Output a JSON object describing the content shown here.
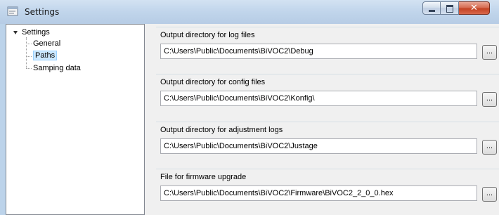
{
  "window": {
    "title": "Settings",
    "app_icon": "settings-window-icon",
    "close_glyph": "✕"
  },
  "tree": {
    "root": "Settings",
    "items": [
      {
        "label": "General",
        "selected": false
      },
      {
        "label": "Paths",
        "selected": true
      },
      {
        "label": "Samping data",
        "selected": false
      }
    ]
  },
  "paths": {
    "log": {
      "label": "Output directory for log files",
      "value": "C:\\Users\\Public\\Documents\\BiVOC2\\Debug"
    },
    "config": {
      "label": "Output directory for config files",
      "value": "C:\\Users\\Public\\Documents\\BiVOC2\\Konfig\\"
    },
    "adjustment": {
      "label": "Output directory for adjustment logs",
      "value": "C:\\Users\\Public\\Documents\\BiVOC2\\Justage"
    },
    "firmware": {
      "label": "File for firmware upgrade",
      "value": "C:\\Users\\Public\\Documents\\BiVOC2\\Firmware\\BiVOC2_2_0_0.hex"
    },
    "browse_label": "..."
  },
  "colors": {
    "selection": "#cce8ff",
    "close_button": "#c44324"
  }
}
